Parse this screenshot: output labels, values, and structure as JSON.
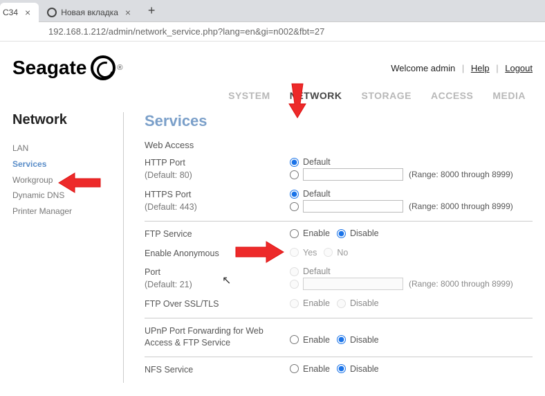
{
  "browser": {
    "tab1_label": "C34",
    "tab2_label": "Новая вкладка",
    "url": "192.168.1.212/admin/network_service.php?lang=en&gi=n002&fbt=27"
  },
  "header": {
    "brand": "Seagate",
    "welcome": "Welcome admin",
    "help": "Help",
    "logout": "Logout"
  },
  "nav": {
    "system": "SYSTEM",
    "network": "NETWORK",
    "storage": "STORAGE",
    "access": "ACCESS",
    "media": "MEDIA"
  },
  "sidebar": {
    "title": "Network",
    "items": [
      "LAN",
      "Services",
      "Workgroup",
      "Dynamic DNS",
      "Printer Manager"
    ]
  },
  "services": {
    "title": "Services",
    "web_access": "Web Access",
    "http_port": "HTTP Port",
    "http_default": "(Default: 80)",
    "https_port": "HTTPS Port",
    "https_default": "(Default: 443)",
    "default_label": "Default",
    "range_note": "(Range: 8000 through 8999)",
    "ftp_service": "FTP Service",
    "enable": "Enable",
    "disable": "Disable",
    "enable_anon": "Enable Anonymous",
    "yes": "Yes",
    "no": "No",
    "port": "Port",
    "port_default": "(Default: 21)",
    "ftp_ssl": "FTP Over SSL/TLS",
    "upnp": "UPnP Port Forwarding for Web Access & FTP Service",
    "nfs": "NFS Service"
  }
}
